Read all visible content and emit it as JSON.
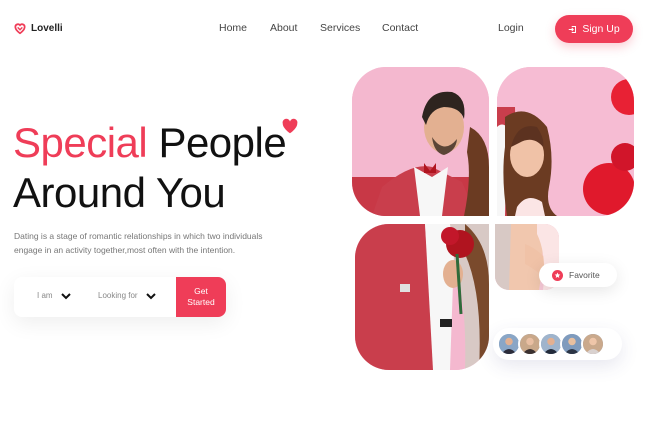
{
  "brand": {
    "name": "Lovelli",
    "color": "#ef3d58"
  },
  "nav": {
    "items": [
      {
        "label": "Home"
      },
      {
        "label": "About"
      },
      {
        "label": "Services"
      },
      {
        "label": "Contact"
      }
    ],
    "login_label": "Login",
    "signup_label": "Sign Up"
  },
  "hero": {
    "title_accent": "Special",
    "title_rest": "People",
    "title_line2": "Around You",
    "description": "Dating is a stage of romantic relationships in which two individuals engage in an activity together,most often with the intention."
  },
  "search": {
    "i_am_label": "I am",
    "looking_for_label": "Looking for",
    "cta_label": "Get Started"
  },
  "gallery": {
    "favorite_label": "Favorite",
    "avatar_count": 5
  }
}
